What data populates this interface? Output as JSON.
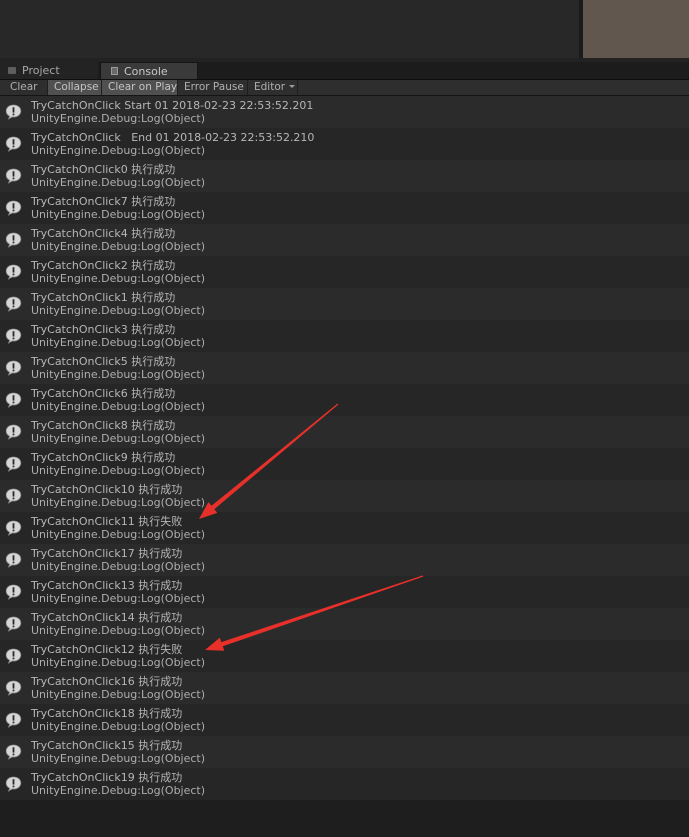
{
  "tabs": [
    {
      "label": "Project",
      "icon": "folder-icon"
    },
    {
      "label": "Console",
      "icon": "console-icon"
    }
  ],
  "toolbar": {
    "clear": "Clear",
    "collapse": "Collapse",
    "clear_on_play": "Clear on Play",
    "error_pause": "Error Pause",
    "editor": "Editor"
  },
  "logs": [
    {
      "msg": "TryCatchOnClick Start 01 2018-02-23 22:53:52.201",
      "trace": "UnityEngine.Debug:Log(Object)"
    },
    {
      "msg": "TryCatchOnClick   End 01 2018-02-23 22:53:52.210",
      "trace": "UnityEngine.Debug:Log(Object)"
    },
    {
      "msg": "TryCatchOnClick0 执行成功",
      "trace": "UnityEngine.Debug:Log(Object)"
    },
    {
      "msg": "TryCatchOnClick7 执行成功",
      "trace": "UnityEngine.Debug:Log(Object)"
    },
    {
      "msg": "TryCatchOnClick4 执行成功",
      "trace": "UnityEngine.Debug:Log(Object)"
    },
    {
      "msg": "TryCatchOnClick2 执行成功",
      "trace": "UnityEngine.Debug:Log(Object)"
    },
    {
      "msg": "TryCatchOnClick1 执行成功",
      "trace": "UnityEngine.Debug:Log(Object)"
    },
    {
      "msg": "TryCatchOnClick3 执行成功",
      "trace": "UnityEngine.Debug:Log(Object)"
    },
    {
      "msg": "TryCatchOnClick5 执行成功",
      "trace": "UnityEngine.Debug:Log(Object)"
    },
    {
      "msg": "TryCatchOnClick6 执行成功",
      "trace": "UnityEngine.Debug:Log(Object)"
    },
    {
      "msg": "TryCatchOnClick8 执行成功",
      "trace": "UnityEngine.Debug:Log(Object)"
    },
    {
      "msg": "TryCatchOnClick9 执行成功",
      "trace": "UnityEngine.Debug:Log(Object)"
    },
    {
      "msg": "TryCatchOnClick10 执行成功",
      "trace": "UnityEngine.Debug:Log(Object)"
    },
    {
      "msg": "TryCatchOnClick11 执行失败",
      "trace": "UnityEngine.Debug:Log(Object)"
    },
    {
      "msg": "TryCatchOnClick17 执行成功",
      "trace": "UnityEngine.Debug:Log(Object)"
    },
    {
      "msg": "TryCatchOnClick13 执行成功",
      "trace": "UnityEngine.Debug:Log(Object)"
    },
    {
      "msg": "TryCatchOnClick14 执行成功",
      "trace": "UnityEngine.Debug:Log(Object)"
    },
    {
      "msg": "TryCatchOnClick12 执行失败",
      "trace": "UnityEngine.Debug:Log(Object)"
    },
    {
      "msg": "TryCatchOnClick16 执行成功",
      "trace": "UnityEngine.Debug:Log(Object)"
    },
    {
      "msg": "TryCatchOnClick18 执行成功",
      "trace": "UnityEngine.Debug:Log(Object)"
    },
    {
      "msg": "TryCatchOnClick15 执行成功",
      "trace": "UnityEngine.Debug:Log(Object)"
    },
    {
      "msg": "TryCatchOnClick19 执行成功",
      "trace": "UnityEngine.Debug:Log(Object)"
    }
  ],
  "log_icon": "info-message-icon",
  "annotation_color": "#e8302a"
}
